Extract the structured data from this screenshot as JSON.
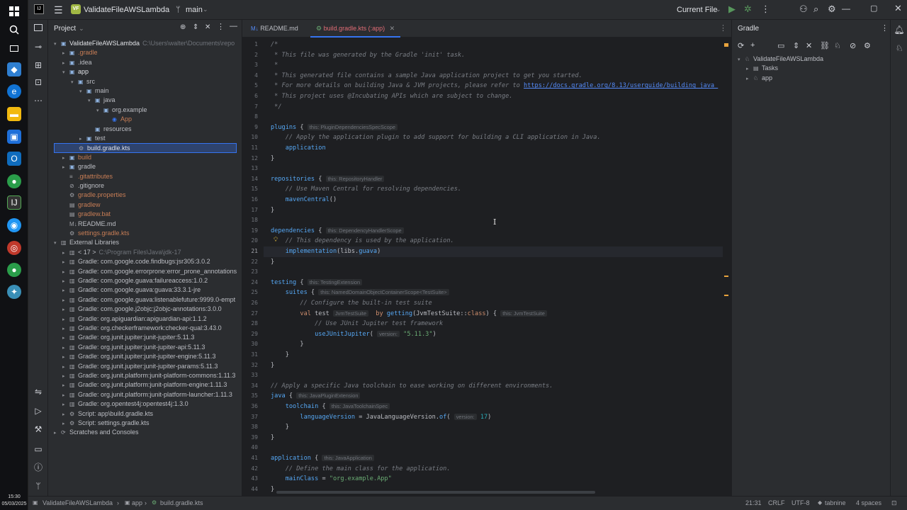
{
  "window": {
    "project_badge": "VF",
    "project_name": "ValidateFileAWSLambda",
    "branch": "main",
    "run_config": "Current File"
  },
  "project_panel": {
    "title": "Project",
    "rows": [
      {
        "depth": 0,
        "arrow": "▾",
        "icon": "▣",
        "label": "ValidateFileAWSLambda",
        "extra": "C:\\Users\\walter\\Documents\\repo",
        "color": "#dfe1e5"
      },
      {
        "depth": 1,
        "arrow": "▸",
        "icon": "▣",
        "label": ".gradle",
        "extra": "",
        "color": "#c77d55"
      },
      {
        "depth": 1,
        "arrow": "▸",
        "icon": "▣",
        "label": ".idea",
        "extra": "",
        "color": "#bcbec4"
      },
      {
        "depth": 1,
        "arrow": "▾",
        "icon": "▣",
        "label": "app",
        "extra": "",
        "color": "#dfe1e5"
      },
      {
        "depth": 2,
        "arrow": "▾",
        "icon": "▣",
        "label": "src",
        "extra": "",
        "color": "#bcbec4"
      },
      {
        "depth": 3,
        "arrow": "▾",
        "icon": "▣",
        "label": "main",
        "extra": "",
        "color": "#bcbec4"
      },
      {
        "depth": 4,
        "arrow": "▾",
        "icon": "▣",
        "label": "java",
        "extra": "",
        "color": "#bcbec4"
      },
      {
        "depth": 5,
        "arrow": "▾",
        "icon": "▣",
        "label": "org.example",
        "extra": "",
        "color": "#bcbec4"
      },
      {
        "depth": 6,
        "arrow": "",
        "icon": "◉",
        "label": "App",
        "extra": "",
        "color": "#c77d55"
      },
      {
        "depth": 4,
        "arrow": "",
        "icon": "▣",
        "label": "resources",
        "extra": "",
        "color": "#bcbec4"
      },
      {
        "depth": 3,
        "arrow": "▸",
        "icon": "▣",
        "label": "test",
        "extra": "",
        "color": "#bcbec4"
      },
      {
        "depth": 2,
        "arrow": "",
        "icon": "⚙",
        "label": "build.gradle.kts",
        "extra": "",
        "color": "#dfe1e5",
        "selected": true
      },
      {
        "depth": 1,
        "arrow": "▸",
        "icon": "▣",
        "label": "build",
        "extra": "",
        "color": "#c77d55"
      },
      {
        "depth": 1,
        "arrow": "▸",
        "icon": "▣",
        "label": "gradle",
        "extra": "",
        "color": "#bcbec4"
      },
      {
        "depth": 1,
        "arrow": "",
        "icon": "≡",
        "label": ".gitattributes",
        "extra": "",
        "color": "#c77d55"
      },
      {
        "depth": 1,
        "arrow": "",
        "icon": "⊘",
        "label": ".gitignore",
        "extra": "",
        "color": "#bcbec4"
      },
      {
        "depth": 1,
        "arrow": "",
        "icon": "⚙",
        "label": "gradle.properties",
        "extra": "",
        "color": "#c77d55"
      },
      {
        "depth": 1,
        "arrow": "",
        "icon": "▤",
        "label": "gradlew",
        "extra": "",
        "color": "#c77d55"
      },
      {
        "depth": 1,
        "arrow": "",
        "icon": "▤",
        "label": "gradlew.bat",
        "extra": "",
        "color": "#c77d55"
      },
      {
        "depth": 1,
        "arrow": "",
        "icon": "M↓",
        "label": "README.md",
        "extra": "",
        "color": "#bcbec4"
      },
      {
        "depth": 1,
        "arrow": "",
        "icon": "⚙",
        "label": "settings.gradle.kts",
        "extra": "",
        "color": "#c77d55"
      },
      {
        "depth": 0,
        "arrow": "▾",
        "icon": "▥",
        "label": "External Libraries",
        "extra": "",
        "color": "#bcbec4"
      },
      {
        "depth": 1,
        "arrow": "▸",
        "icon": "▥",
        "label": "< 17 >",
        "extra": "C:\\Program Files\\Java\\jdk-17",
        "color": "#bcbec4"
      },
      {
        "depth": 1,
        "arrow": "▸",
        "icon": "▥",
        "label": "Gradle: com.google.code.findbugs:jsr305:3.0.2",
        "extra": "",
        "color": "#bcbec4"
      },
      {
        "depth": 1,
        "arrow": "▸",
        "icon": "▥",
        "label": "Gradle: com.google.errorprone:error_prone_annotations",
        "extra": "",
        "color": "#bcbec4"
      },
      {
        "depth": 1,
        "arrow": "▸",
        "icon": "▥",
        "label": "Gradle: com.google.guava:failureaccess:1.0.2",
        "extra": "",
        "color": "#bcbec4"
      },
      {
        "depth": 1,
        "arrow": "▸",
        "icon": "▥",
        "label": "Gradle: com.google.guava:guava:33.3.1-jre",
        "extra": "",
        "color": "#bcbec4"
      },
      {
        "depth": 1,
        "arrow": "▸",
        "icon": "▥",
        "label": "Gradle: com.google.guava:listenablefuture:9999.0-empt",
        "extra": "",
        "color": "#bcbec4"
      },
      {
        "depth": 1,
        "arrow": "▸",
        "icon": "▥",
        "label": "Gradle: com.google.j2objc:j2objc-annotations:3.0.0",
        "extra": "",
        "color": "#bcbec4"
      },
      {
        "depth": 1,
        "arrow": "▸",
        "icon": "▥",
        "label": "Gradle: org.apiguardian:apiguardian-api:1.1.2",
        "extra": "",
        "color": "#bcbec4"
      },
      {
        "depth": 1,
        "arrow": "▸",
        "icon": "▥",
        "label": "Gradle: org.checkerframework:checker-qual:3.43.0",
        "extra": "",
        "color": "#bcbec4"
      },
      {
        "depth": 1,
        "arrow": "▸",
        "icon": "▥",
        "label": "Gradle: org.junit.jupiter:junit-jupiter:5.11.3",
        "extra": "",
        "color": "#bcbec4"
      },
      {
        "depth": 1,
        "arrow": "▸",
        "icon": "▥",
        "label": "Gradle: org.junit.jupiter:junit-jupiter-api:5.11.3",
        "extra": "",
        "color": "#bcbec4"
      },
      {
        "depth": 1,
        "arrow": "▸",
        "icon": "▥",
        "label": "Gradle: org.junit.jupiter:junit-jupiter-engine:5.11.3",
        "extra": "",
        "color": "#bcbec4"
      },
      {
        "depth": 1,
        "arrow": "▸",
        "icon": "▥",
        "label": "Gradle: org.junit.jupiter:junit-jupiter-params:5.11.3",
        "extra": "",
        "color": "#bcbec4"
      },
      {
        "depth": 1,
        "arrow": "▸",
        "icon": "▥",
        "label": "Gradle: org.junit.platform:junit-platform-commons:1.11.3",
        "extra": "",
        "color": "#bcbec4"
      },
      {
        "depth": 1,
        "arrow": "▸",
        "icon": "▥",
        "label": "Gradle: org.junit.platform:junit-platform-engine:1.11.3",
        "extra": "",
        "color": "#bcbec4"
      },
      {
        "depth": 1,
        "arrow": "▸",
        "icon": "▥",
        "label": "Gradle: org.junit.platform:junit-platform-launcher:1.11.3",
        "extra": "",
        "color": "#bcbec4"
      },
      {
        "depth": 1,
        "arrow": "▸",
        "icon": "▥",
        "label": "Gradle: org.opentest4j:opentest4j:1.3.0",
        "extra": "",
        "color": "#bcbec4"
      },
      {
        "depth": 1,
        "arrow": "▸",
        "icon": "⚙",
        "label": "Script: app\\build.gradle.kts",
        "extra": "",
        "color": "#bcbec4"
      },
      {
        "depth": 1,
        "arrow": "▸",
        "icon": "⚙",
        "label": "Script: settings.gradle.kts",
        "extra": "",
        "color": "#bcbec4"
      },
      {
        "depth": 0,
        "arrow": "▸",
        "icon": "⟳",
        "label": "Scratches and Consoles",
        "extra": "",
        "color": "#bcbec4"
      }
    ]
  },
  "editor": {
    "tabs": [
      {
        "label": "README.md",
        "icon": "M↓",
        "active": false
      },
      {
        "label": "build.gradle.kts (:app)",
        "icon": "⚙",
        "active": true
      }
    ],
    "current_line": 21,
    "lines": [
      "<span class=\"c\">/*</span>",
      "<span class=\"c\"> * This file was generated by the Gradle 'init' task.</span>",
      "<span class=\"c\"> *</span>",
      "<span class=\"c\"> * This generated file contains a sample Java application project to get you started.</span>",
      "<span class=\"c\"> * For more details on building Java &amp; JVM projects, please refer to </span><span class=\"lnk\">https://docs.gradle.org/8.13/userguide/building_java_</span>",
      "<span class=\"c\"> * This project uses @Incubating APIs which are subject to change.</span>",
      "<span class=\"c\"> */</span>",
      "",
      "<span class=\"f\">plugins</span> { <span class=\"h\">this: PluginDependenciesSpecScope</span>",
      "    <span class=\"c\">// Apply the application plugin to add support for building a CLI application in Java.</span>",
      "    <span class=\"f\">application</span>",
      "}",
      "",
      "<span class=\"f\">repositories</span> { <span class=\"h\">this: RepositoryHandler</span>",
      "    <span class=\"c\">// Use Maven Central for resolving dependencies.</span>",
      "    <span class=\"f\">mavenCentral</span>()",
      "}",
      "",
      "<span class=\"f\">dependencies</span> { <span class=\"h\">this: DependencyHandlerScope</span>",
      "    <span class=\"c\">// This dependency is used by the application.</span>",
      "    <span class=\"f\">implementation</span>(libs.<span class=\"f\">guava</span>)",
      "}",
      "",
      "<span class=\"f\">testing</span> { <span class=\"h\">this: TestingExtension</span>",
      "    <span class=\"f\">suites</span> { <span class=\"h\">this: NamedDomainObjectContainerScope&lt;TestSuite&gt;</span>",
      "        <span class=\"c\">// Configure the built-in test suite</span>",
      "        <span class=\"k\">val</span> test <span class=\"h\">JvmTestSuite</span>  <span class=\"k\">by</span> <span class=\"f\">getting</span>(JvmTestSuite::<span class=\"k\">class</span>) { <span class=\"h\">this: JvmTestSuite</span>",
      "            <span class=\"c\">// Use JUnit Jupiter test framework</span>",
      "            <span class=\"f\">useJUnitJupiter</span>( <span class=\"h\">version:</span> <span class=\"s\">\"5.11.3\"</span>)",
      "        }",
      "    }",
      "}",
      "",
      "<span class=\"c\">// Apply a specific Java toolchain to ease working on different environments.</span>",
      "<span class=\"f\">java</span> { <span class=\"h\">this: JavaPluginExtension</span>",
      "    <span class=\"f\">toolchain</span> { <span class=\"h\">this: JavaToolchainSpec</span>",
      "        <span class=\"f\">languageVersion</span> = JavaLanguageVersion.<span class=\"f\">of</span>( <span class=\"h\">version:</span> <span class=\"n\">17</span>)",
      "    }",
      "}",
      "",
      "<span class=\"f\">application</span> { <span class=\"h\">this: JavaApplication</span>",
      "    <span class=\"c\">// Define the main class for the application.</span>",
      "    <span class=\"f\">mainClass</span> = <span class=\"s\">\"org.example.App\"</span>",
      "}"
    ]
  },
  "gradle_panel": {
    "title": "Gradle",
    "rows": [
      {
        "depth": 0,
        "arrow": "▾",
        "label": "ValidateFileAWSLambda"
      },
      {
        "depth": 1,
        "arrow": "▸",
        "label": "Tasks"
      },
      {
        "depth": 1,
        "arrow": "▸",
        "label": "app"
      }
    ]
  },
  "statusbar": {
    "crumbs": [
      "ValidateFileAWSLambda",
      "app",
      "build.gradle.kts"
    ],
    "position": "21:31",
    "line_sep": "CRLF",
    "encoding": "UTF-8",
    "plugin": "tabnine",
    "indent": "4 spaces"
  },
  "clock": {
    "time": "15:30",
    "date": "05/03/2025"
  }
}
